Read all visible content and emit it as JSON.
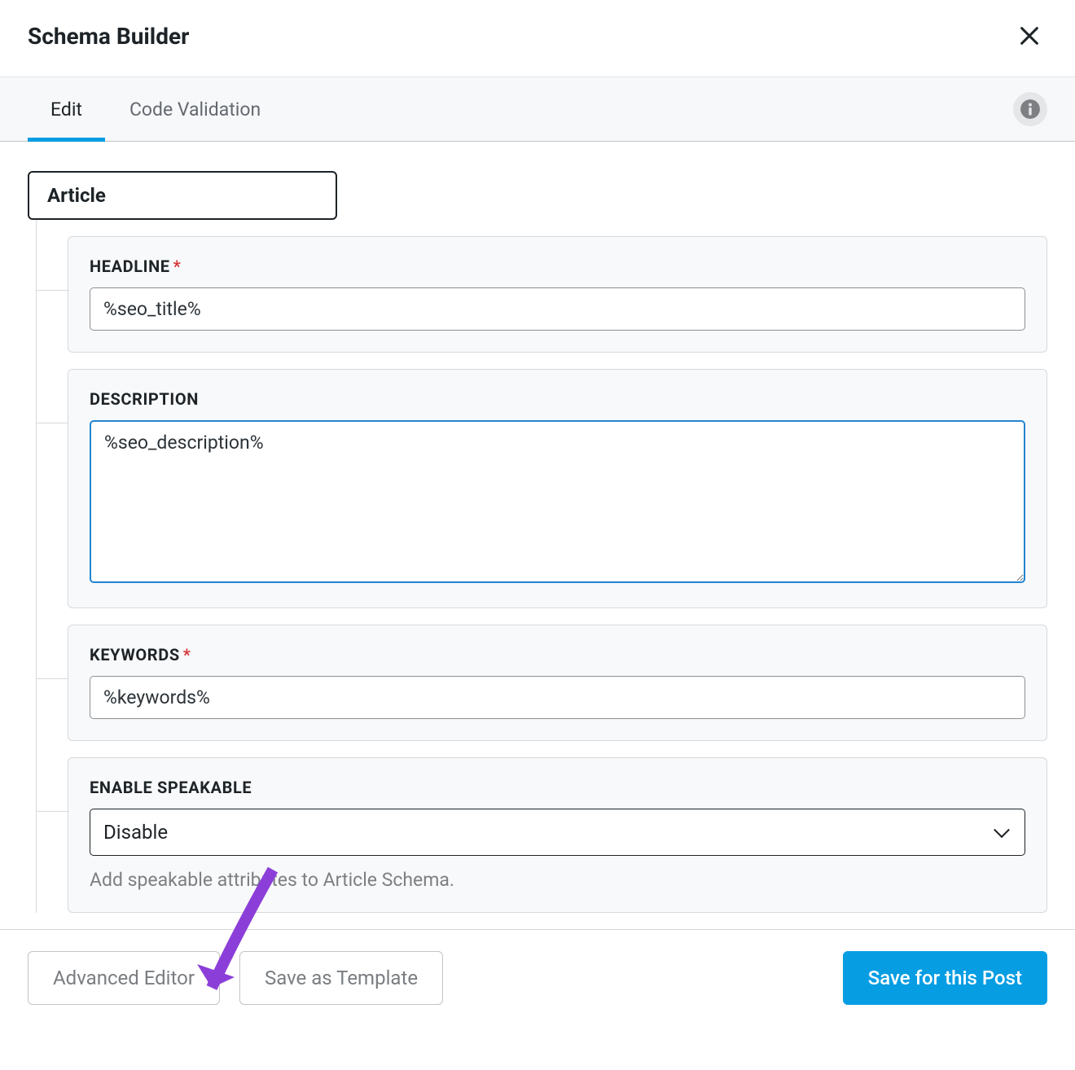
{
  "header": {
    "title": "Schema Builder"
  },
  "tabs": {
    "edit": "Edit",
    "validation": "Code Validation"
  },
  "schema": {
    "type_label": "Article"
  },
  "fields": {
    "headline": {
      "label": "HEADLINE",
      "value": "%seo_title%"
    },
    "description": {
      "label": "DESCRIPTION",
      "value": "%seo_description%"
    },
    "keywords": {
      "label": "KEYWORDS",
      "value": "%keywords%"
    },
    "speakable": {
      "label": "ENABLE SPEAKABLE",
      "value": "Disable",
      "helper": "Add speakable attributes to Article Schema."
    }
  },
  "footer": {
    "advanced": "Advanced Editor",
    "template": "Save as Template",
    "save": "Save for this Post"
  }
}
